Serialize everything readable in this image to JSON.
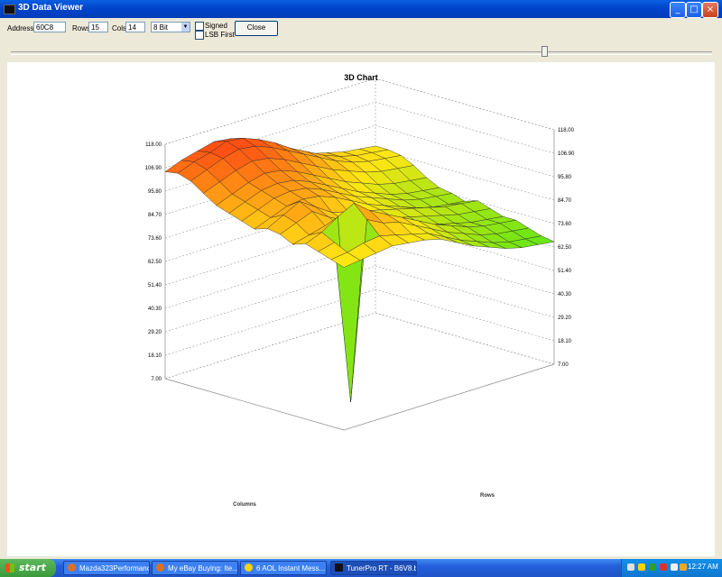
{
  "window": {
    "title": "3D Data Viewer"
  },
  "controls": {
    "address_label": "Address",
    "address_value": "60C8",
    "rows_label": "Rows",
    "rows_value": "15",
    "cols_label": "Cols",
    "cols_value": "14",
    "bits_value": "8 Bit",
    "signed_label": "Signed",
    "signed_checked": false,
    "lsb_label": "LSB First",
    "lsb_checked": false,
    "close_label": "Close"
  },
  "slider": {
    "position": 0.76
  },
  "chart_data": {
    "type": "surface3d",
    "title": "3D Chart",
    "xlabel": "Columns",
    "ylabel": "Rows",
    "z_ticks": [
      "7.00",
      "18.10",
      "29.20",
      "40.30",
      "51.40",
      "62.50",
      "73.60",
      "84.70",
      "95.80",
      "106.90",
      "118.00"
    ],
    "zlim": [
      7,
      118
    ],
    "rows": 15,
    "cols": 14,
    "values": [
      [
        105,
        108,
        110,
        112,
        111,
        108,
        104,
        100,
        96,
        92,
        90,
        88,
        87,
        86
      ],
      [
        106,
        109,
        111,
        114,
        113,
        110,
        106,
        101,
        97,
        93,
        90,
        88,
        87,
        86
      ],
      [
        104,
        107,
        110,
        112,
        111,
        108,
        104,
        100,
        96,
        92,
        89,
        87,
        86,
        85
      ],
      [
        100,
        103,
        106,
        108,
        107,
        104,
        100,
        96,
        92,
        89,
        86,
        84,
        83,
        82
      ],
      [
        96,
        99,
        102,
        104,
        103,
        100,
        96,
        92,
        88,
        85,
        82,
        80,
        79,
        78
      ],
      [
        94,
        97,
        100,
        101,
        100,
        97,
        93,
        89,
        85,
        82,
        79,
        77,
        76,
        75
      ],
      [
        92,
        95,
        98,
        99,
        98,
        95,
        91,
        87,
        84,
        81,
        78,
        76,
        75,
        74
      ],
      [
        90,
        93,
        96,
        97,
        96,
        93,
        89,
        85,
        82,
        79,
        76,
        74,
        73,
        72
      ],
      [
        92,
        96,
        100,
        95,
        90,
        88,
        86,
        84,
        82,
        80,
        78,
        76,
        75,
        74
      ],
      [
        91,
        94,
        97,
        92,
        88,
        86,
        84,
        82,
        80,
        78,
        76,
        74,
        73,
        72
      ],
      [
        88,
        90,
        92,
        89,
        86,
        84,
        82,
        80,
        78,
        76,
        74,
        72,
        71,
        70
      ],
      [
        90,
        93,
        98,
        102,
        96,
        92,
        88,
        84,
        80,
        77,
        74,
        72,
        71,
        70
      ],
      [
        88,
        90,
        12,
        96,
        92,
        90,
        86,
        82,
        78,
        75,
        72,
        70,
        69,
        68
      ],
      [
        86,
        87,
        89,
        90,
        88,
        86,
        84,
        80,
        76,
        73,
        70,
        68,
        67,
        66
      ],
      [
        84,
        85,
        86,
        87,
        86,
        85,
        83,
        79,
        75,
        72,
        69,
        67,
        66,
        65
      ]
    ]
  },
  "taskbar": {
    "start_label": "start",
    "items": [
      "Mazda323Performanc...",
      "My eBay Buying: Ite...",
      "6 AOL Instant Mess...",
      "TunerPro RT - B6V8.b..."
    ],
    "clock": "12:27 AM"
  }
}
